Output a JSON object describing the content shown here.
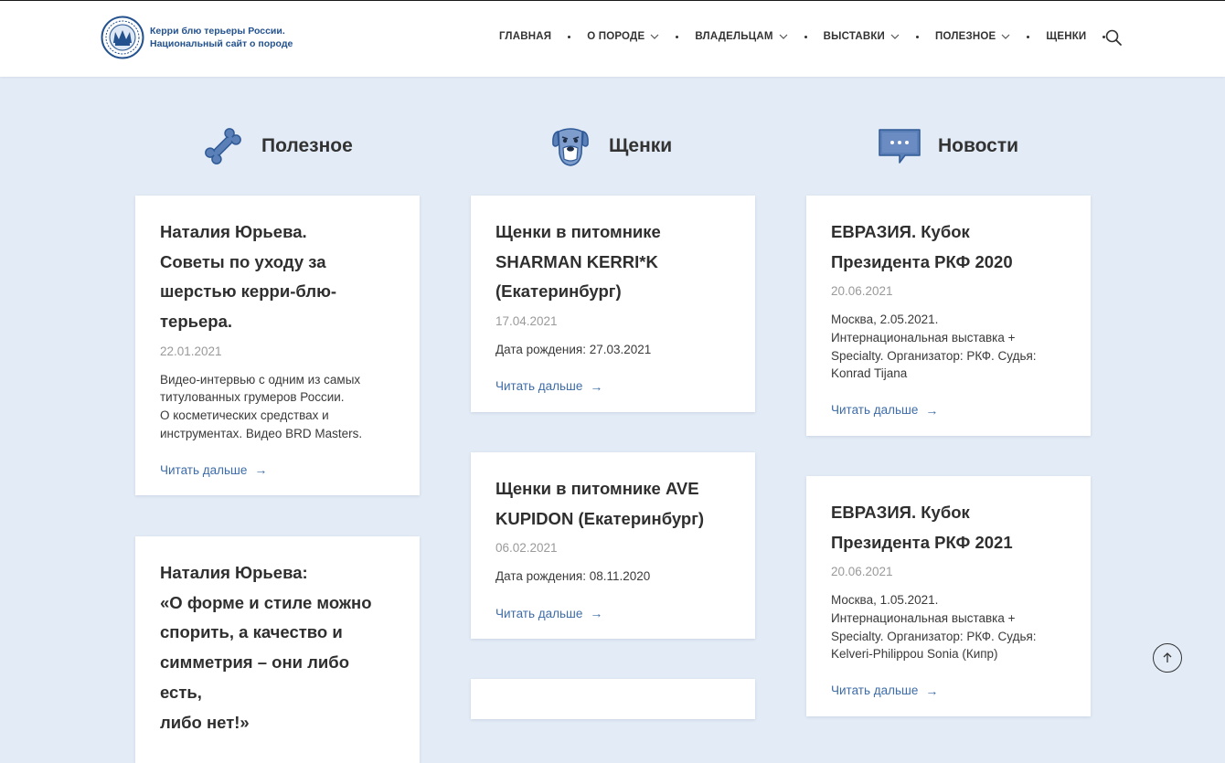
{
  "site": {
    "logo_line1": "Керри блю терьеры России.",
    "logo_line2": "Национальный сайт о породе"
  },
  "nav": [
    {
      "label": "ГЛАВНАЯ",
      "has_dropdown": false
    },
    {
      "label": "О ПОРОДЕ",
      "has_dropdown": true
    },
    {
      "label": "ВЛАДЕЛЬЦАМ",
      "has_dropdown": true
    },
    {
      "label": "ВЫСТАВКИ",
      "has_dropdown": true
    },
    {
      "label": "ПОЛЕЗНОЕ",
      "has_dropdown": true
    },
    {
      "label": "ЩЕНКИ",
      "has_dropdown": false
    }
  ],
  "icons": {
    "search": "search-icon",
    "scroll_top": "arrow-up-icon"
  },
  "colors": {
    "accent": "#3d6ca8",
    "icon_blue": "#5b80b8",
    "background": "#e2ebf6"
  },
  "columns": [
    {
      "title": "Полезное",
      "icon": "bone-icon",
      "cards": [
        {
          "title_lines": [
            "Наталия Юрьева.",
            "Советы по уходу за",
            "шерстью керри-блю-",
            "терьера."
          ],
          "date": "22.01.2021",
          "text_lines": [
            "Видео-интервью с одним из самых",
            "титулованных грумеров России.",
            "О косметических средствах и",
            "инструментах. Видео BRD Masters."
          ],
          "link": "Читать дальше"
        },
        {
          "title_lines": [
            "Наталия Юрьева:",
            "«О форме и стиле можно",
            "спорить, а качество и",
            "симметрия – они либо есть,",
            "либо нет!»"
          ],
          "date": "",
          "text_lines": [],
          "link": ""
        }
      ]
    },
    {
      "title": "Щенки",
      "icon": "dog-head-icon",
      "cards": [
        {
          "title_lines": [
            "Щенки в питомнике",
            "SHARMAN KERRI*K",
            "(Екатеринбург)"
          ],
          "date": "17.04.2021",
          "text_lines": [
            "Дата рождения: 27.03.2021"
          ],
          "link": "Читать дальше"
        },
        {
          "title_lines": [
            "Щенки в питомнике AVE",
            "KUPIDON (Екатеринбург)"
          ],
          "date": "06.02.2021",
          "text_lines": [
            "Дата рождения: 08.11.2020"
          ],
          "link": "Читать дальше"
        }
      ]
    },
    {
      "title": "Новости",
      "icon": "chat-bubble-icon",
      "cards": [
        {
          "title_lines": [
            "ЕВРАЗИЯ. Кубок",
            "Президента РКФ 2020"
          ],
          "date": "20.06.2021",
          "text_lines": [
            "Москва, 2.05.2021.",
            "Интернациональная выставка +",
            "Specialty. Организатор: РКФ. Судья:",
            "Konrad Tijana"
          ],
          "link": "Читать дальше"
        },
        {
          "title_lines": [
            "ЕВРАЗИЯ. Кубок",
            "Президента РКФ 2021"
          ],
          "date": "20.06.2021",
          "text_lines": [
            "Москва, 1.05.2021.",
            "Интернациональная выставка +",
            "Specialty. Организатор: РКФ. Судья:",
            "Kelveri-Philippou Sonia (Кипр)"
          ],
          "link": "Читать дальше"
        }
      ]
    }
  ]
}
